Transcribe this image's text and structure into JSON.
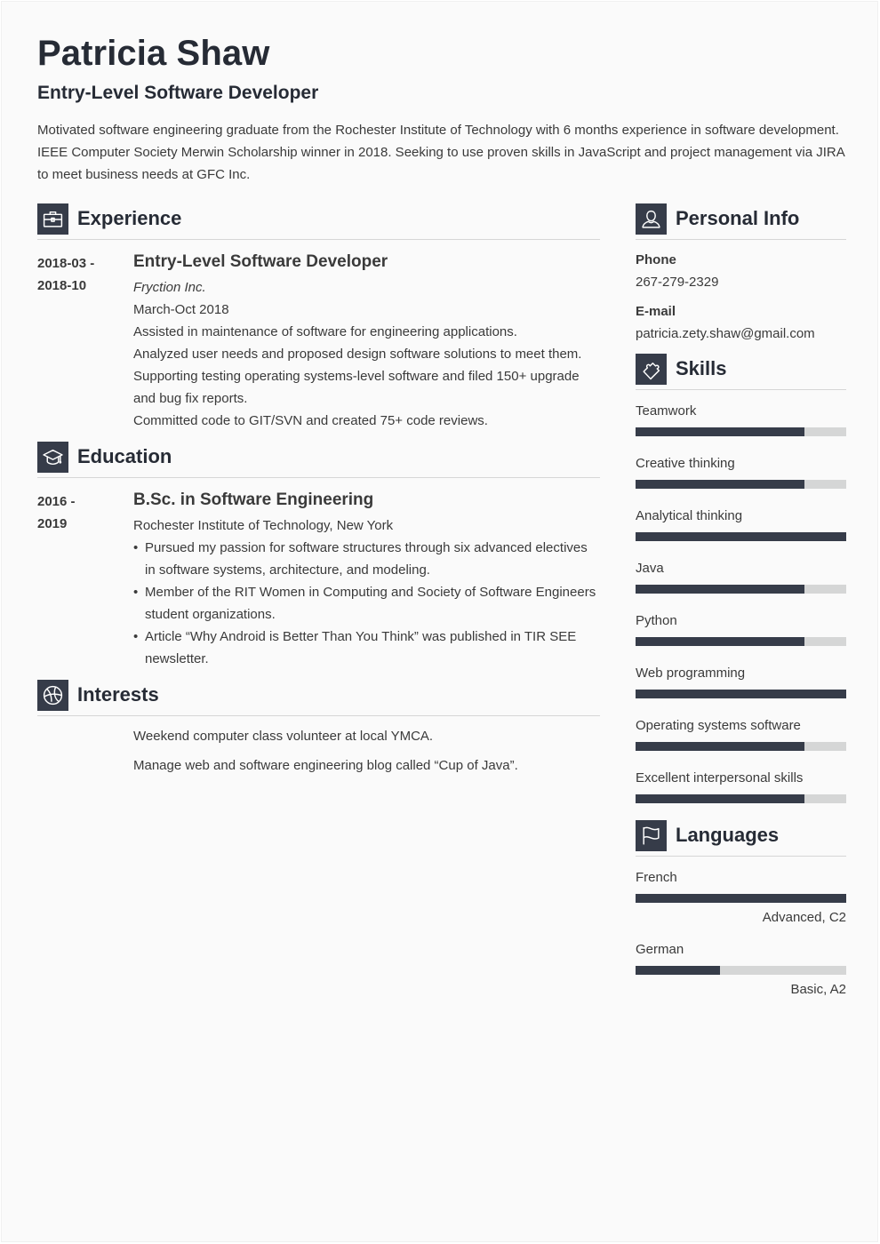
{
  "header": {
    "name": "Patricia Shaw",
    "title": "Entry-Level Software Developer",
    "summary": "Motivated software engineering graduate from the Rochester Institute of Technology with 6 months experience in software development. IEEE Computer Society Merwin Scholarship winner in 2018. Seeking to use proven skills in JavaScript and project management via JIRA to meet business needs at GFC Inc."
  },
  "colors": {
    "accent": "#363c49",
    "bar_track": "#d5d6d6",
    "heading": "#262b35",
    "text": "#3a3a3a",
    "page_background": "#fafafa"
  },
  "experience": {
    "heading": "Experience",
    "icon": "briefcase-icon",
    "items": [
      {
        "date_start": "2018-03 -",
        "date_end": "2018-10",
        "role": "Entry-Level Software Developer",
        "company": "Fryction Inc.",
        "period": "March-Oct 2018",
        "duties": [
          "Assisted in maintenance of software for engineering applications.",
          "Analyzed user needs and proposed design software solutions to meet them.",
          "Supporting testing operating systems-level software and filed 150+ upgrade and bug fix reports.",
          "Committed code to GIT/SVN and created 75+ code reviews."
        ]
      }
    ]
  },
  "education": {
    "heading": "Education",
    "icon": "graduation-cap-icon",
    "items": [
      {
        "date_start": "2016 -",
        "date_end": "2019",
        "degree": "B.Sc. in Software Engineering",
        "school": "Rochester Institute of Technology, New York",
        "bullets": [
          "Pursued my passion for software structures through six advanced electives in software systems, architecture, and modeling.",
          "Member of the RIT Women in Computing and Society of Software Engineers student organizations.",
          "Article “Why Android is Better Than You Think” was published in TIR SEE newsletter."
        ]
      }
    ]
  },
  "interests": {
    "heading": "Interests",
    "icon": "basketball-icon",
    "items": [
      "Weekend computer class volunteer at local YMCA.",
      "Manage web and software engineering blog called “Cup of Java”."
    ]
  },
  "personal_info": {
    "heading": "Personal Info",
    "icon": "user-icon",
    "phone_label": "Phone",
    "phone": "267-279-2329",
    "email_label": "E-mail",
    "email": "patricia.zety.shaw@gmail.com"
  },
  "skills": {
    "heading": "Skills",
    "icon": "puzzle-piece-icon",
    "items": [
      {
        "name": "Teamwork",
        "level": 0.8
      },
      {
        "name": "Creative thinking",
        "level": 0.8
      },
      {
        "name": "Analytical thinking",
        "level": 1.0
      },
      {
        "name": "Java",
        "level": 0.8
      },
      {
        "name": "Python",
        "level": 0.8
      },
      {
        "name": "Web programming",
        "level": 1.0
      },
      {
        "name": "Operating systems software",
        "level": 0.8
      },
      {
        "name": "Excellent interpersonal skills",
        "level": 0.8
      }
    ]
  },
  "languages": {
    "heading": "Languages",
    "icon": "flag-icon",
    "items": [
      {
        "name": "French",
        "level": 1.0,
        "level_label": "Advanced, C2"
      },
      {
        "name": "German",
        "level": 0.4,
        "level_label": "Basic, A2"
      }
    ]
  }
}
